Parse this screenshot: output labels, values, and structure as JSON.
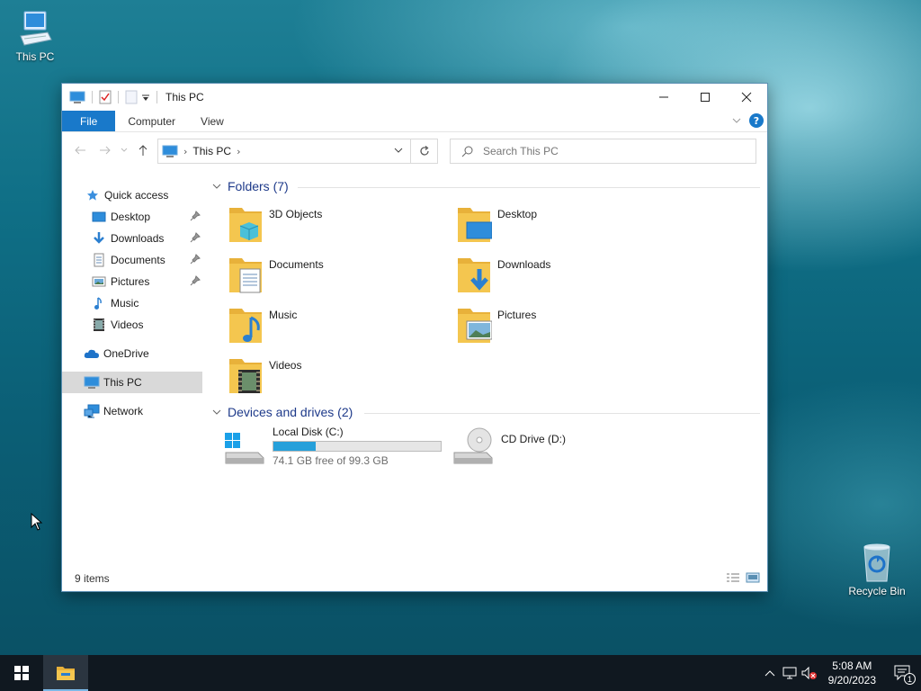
{
  "desktop": {
    "icons": [
      {
        "label": "This PC",
        "icon": "this-pc-icon"
      },
      {
        "label": "Recycle Bin",
        "icon": "recycle-bin-icon"
      }
    ]
  },
  "window": {
    "title": "This PC",
    "ribbon_tabs": [
      "File",
      "Computer",
      "View"
    ],
    "address": {
      "path": [
        "This PC"
      ]
    },
    "search_placeholder": "Search This PC",
    "status": "9 items"
  },
  "navigation": {
    "items": [
      {
        "label": "Quick access",
        "icon": "star-icon",
        "pinned": false,
        "selected": false
      },
      {
        "label": "Desktop",
        "icon": "desktop-icon",
        "pinned": true,
        "selected": false
      },
      {
        "label": "Downloads",
        "icon": "download-icon",
        "pinned": true,
        "selected": false
      },
      {
        "label": "Documents",
        "icon": "document-icon",
        "pinned": true,
        "selected": false
      },
      {
        "label": "Pictures",
        "icon": "pictures-icon",
        "pinned": true,
        "selected": false
      },
      {
        "label": "Music",
        "icon": "music-icon",
        "pinned": false,
        "selected": false
      },
      {
        "label": "Videos",
        "icon": "videos-icon",
        "pinned": false,
        "selected": false
      },
      {
        "label": "OneDrive",
        "icon": "cloud-icon",
        "pinned": false,
        "selected": false
      },
      {
        "label": "This PC",
        "icon": "this-pc-icon",
        "pinned": false,
        "selected": true
      },
      {
        "label": "Network",
        "icon": "network-icon",
        "pinned": false,
        "selected": false
      }
    ]
  },
  "folders": {
    "header": "Folders (7)",
    "items": [
      {
        "name": "3D Objects",
        "icon": "3d-objects-icon"
      },
      {
        "name": "Desktop",
        "icon": "desktop-folder-icon"
      },
      {
        "name": "Documents",
        "icon": "documents-folder-icon"
      },
      {
        "name": "Downloads",
        "icon": "downloads-folder-icon"
      },
      {
        "name": "Music",
        "icon": "music-folder-icon"
      },
      {
        "name": "Pictures",
        "icon": "pictures-folder-icon"
      },
      {
        "name": "Videos",
        "icon": "videos-folder-icon"
      }
    ]
  },
  "drives": {
    "header": "Devices and drives (2)",
    "items": [
      {
        "name": "Local Disk (C:)",
        "free_text": "74.1 GB free of 99.3 GB",
        "used_fraction": 0.254
      },
      {
        "name": "CD Drive (D:)"
      }
    ]
  },
  "taskbar": {
    "time": "5:08 AM",
    "date": "9/20/2023",
    "notification_count": "1"
  },
  "colors": {
    "accent": "#1979ca",
    "selection": "#d9d9d9",
    "progress": "#26a0da",
    "folder": "#f4c64f"
  }
}
